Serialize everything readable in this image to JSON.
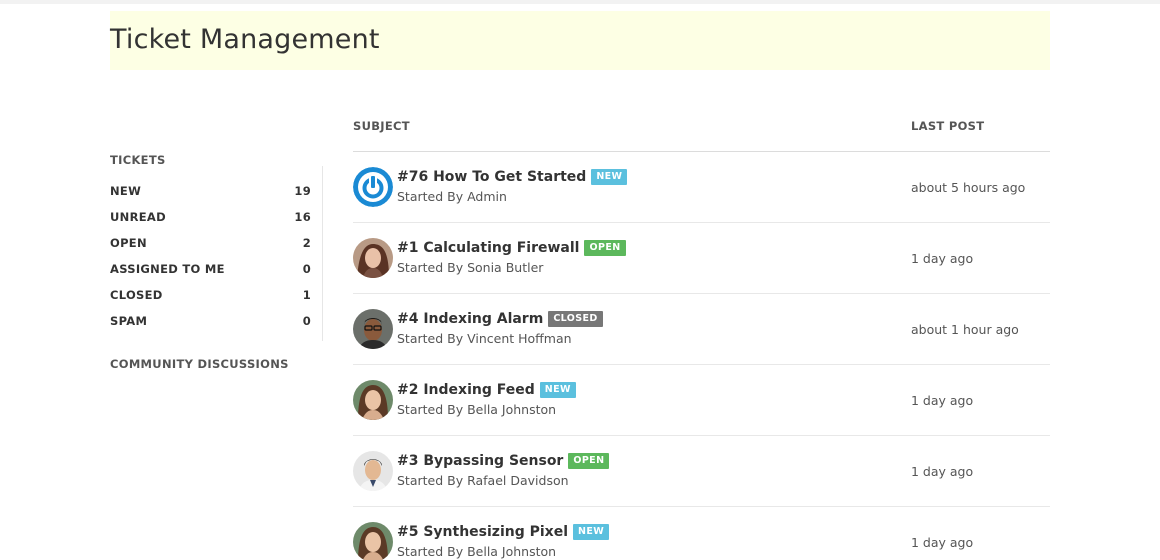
{
  "header": {
    "title": "Ticket Management"
  },
  "sidebar": {
    "tickets_heading": "TICKETS",
    "items": [
      {
        "label": "NEW",
        "count": "19"
      },
      {
        "label": "UNREAD",
        "count": "16"
      },
      {
        "label": "OPEN",
        "count": "2"
      },
      {
        "label": "ASSIGNED TO ME",
        "count": "0"
      },
      {
        "label": "CLOSED",
        "count": "1"
      },
      {
        "label": "SPAM",
        "count": "0"
      }
    ],
    "community": "COMMUNITY DISCUSSIONS"
  },
  "table": {
    "subject_header": "SUBJECT",
    "lastpost_header": "LAST POST",
    "rows": [
      {
        "title": "#76 How To Get Started",
        "badge": "NEW",
        "status": "new",
        "starter": "Started By Admin",
        "time": "about 5 hours ago",
        "avatar": "power-logo-icon"
      },
      {
        "title": "#1 Calculating Firewall",
        "badge": "OPEN",
        "status": "open",
        "starter": "Started By Sonia Butler",
        "time": "1 day ago",
        "avatar": "user-photo"
      },
      {
        "title": "#4 Indexing Alarm",
        "badge": "CLOSED",
        "status": "closed",
        "starter": "Started By Vincent Hoffman",
        "time": "about 1 hour ago",
        "avatar": "user-photo"
      },
      {
        "title": "#2 Indexing Feed",
        "badge": "NEW",
        "status": "new",
        "starter": "Started By Bella Johnston",
        "time": "1 day ago",
        "avatar": "user-photo"
      },
      {
        "title": "#3 Bypassing Sensor",
        "badge": "OPEN",
        "status": "open",
        "starter": "Started By Rafael Davidson",
        "time": "1 day ago",
        "avatar": "user-photo"
      },
      {
        "title": "#5 Synthesizing Pixel",
        "badge": "NEW",
        "status": "new",
        "starter": "Started By Bella Johnston",
        "time": "1 day ago",
        "avatar": "user-photo"
      }
    ]
  },
  "colors": {
    "header_bg": "#fdffe4",
    "badge_new": "#5bc0de",
    "badge_open": "#5cb85c",
    "badge_closed": "#777777",
    "logo_blue": "#1a8ad4"
  }
}
